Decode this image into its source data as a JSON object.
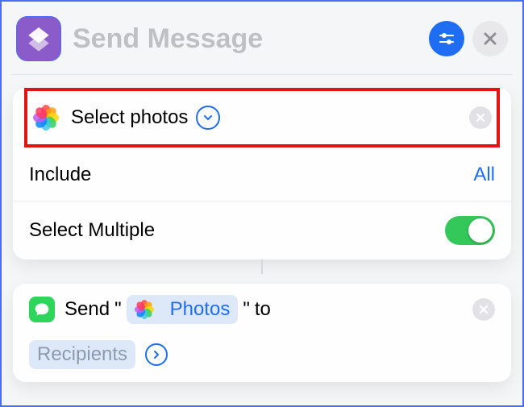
{
  "header": {
    "title": "Send Message"
  },
  "card1": {
    "select_photos_label": "Select photos",
    "include_label": "Include",
    "include_value": "All",
    "select_multiple_label": "Select Multiple",
    "select_multiple_on": true
  },
  "card2": {
    "send_prefix": "Send",
    "quote_open": "\"",
    "photos_pill": "Photos",
    "quote_close": "\"",
    "to_word": "to",
    "recipients_pill": "Recipients"
  }
}
